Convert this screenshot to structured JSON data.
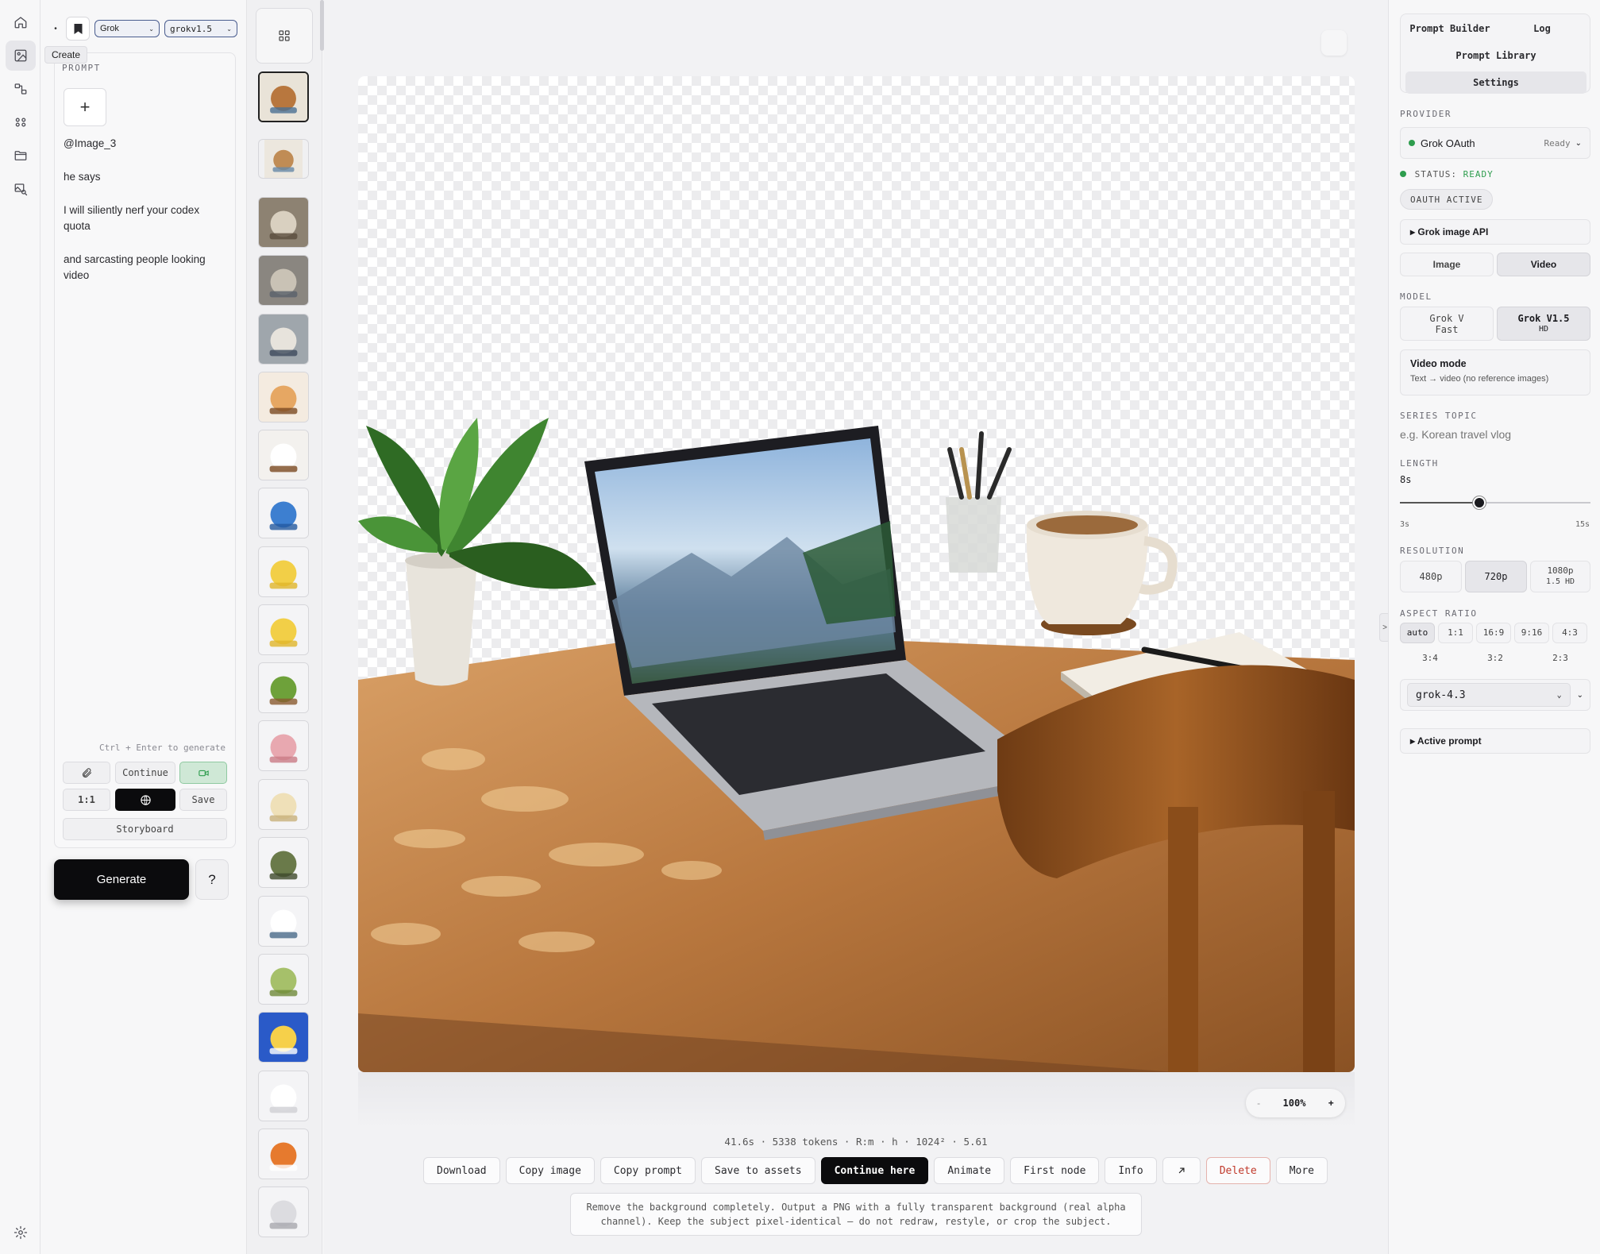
{
  "rail": {
    "tooltip": "Create",
    "icons": [
      "home-icon",
      "image-icon",
      "workflow-icon",
      "filters-icon",
      "folder-icon",
      "image-search-icon"
    ],
    "settings_icon": "gear-icon"
  },
  "prompt_panel": {
    "provider_select": "Grok",
    "model_select": "grokv1.5",
    "section_label": "PROMPT",
    "add_label": "+",
    "lines": [
      "@Image_3",
      "he says",
      "I will siliently nerf your codex quota",
      "and sarcasting people looking video"
    ],
    "hint": "Ctrl + Enter to generate",
    "continue_label": "Continue",
    "ratio_label": "1:1",
    "save_label": "Save",
    "storyboard_label": "Storyboard",
    "generate_label": "Generate",
    "help_label": "?"
  },
  "thumbnails": [
    "desk-laptop",
    "desk-laptop-2",
    "room-collage",
    "laptop-room",
    "person-standing",
    "cat-face",
    "coffee-cup",
    "blue-umbrella",
    "yellow-star",
    "yellow-star-2",
    "avocado-character",
    "paper-crane",
    "perfume-bottle",
    "dragon-figure",
    "astronaut-figure",
    "maple-leaf",
    "korean-poster",
    "white-sneaker",
    "fox-face",
    "glass-item"
  ],
  "canvas": {
    "zoom_minus": "-",
    "zoom_value": "100%",
    "zoom_plus": "+",
    "meta": "41.6s · 5338 tokens · R:m · h · 1024² · 5.61",
    "actions": {
      "download": "Download",
      "copy_image": "Copy image",
      "copy_prompt": "Copy prompt",
      "save_assets": "Save to assets",
      "continue_here": "Continue here",
      "animate": "Animate",
      "first_node": "First node",
      "info": "Info",
      "delete": "Delete",
      "more": "More"
    },
    "description": "Remove the background completely. Output a PNG with a fully transparent background (real alpha channel). Keep the subject pixel-identical — do not redraw, restyle, or crop the subject."
  },
  "settings": {
    "tabs": [
      "Prompt Builder",
      "Log",
      "Prompt Library",
      "Settings"
    ],
    "provider_label": "PROVIDER",
    "provider_name": "Grok OAuth",
    "provider_state": "Ready",
    "status_prefix": "STATUS:",
    "status_value": "READY",
    "oauth_badge": "OAUTH ACTIVE",
    "api_section": "▸ Grok image API",
    "mode_image": "Image",
    "mode_video": "Video",
    "model_label": "MODEL",
    "model_a_line1": "Grok V",
    "model_a_line2": "Fast",
    "model_b_line1": "Grok V1.5",
    "model_b_line2": "HD",
    "video_mode_title": "Video mode",
    "video_mode_desc": "Text → video (no reference images)",
    "series_label": "SERIES TOPIC",
    "series_placeholder": "e.g. Korean travel vlog",
    "length_label": "LENGTH",
    "length_value": "8s",
    "length_fraction": 0.417,
    "length_min": "3s",
    "length_max": "15s",
    "resolution_label": "RESOLUTION",
    "res_480": "480p",
    "res_720": "720p",
    "res_1080_line1": "1080p",
    "res_1080_line2": "1.5 HD",
    "aspect_label": "ASPECT RATIO",
    "aspects_row1": [
      "auto",
      "1:1",
      "16:9",
      "9:16",
      "4:3"
    ],
    "aspects_row2": [
      "3:4",
      "3:2",
      "2:3"
    ],
    "llm_select": "grok-4.3",
    "active_prompt": "▸ Active prompt"
  },
  "colors": {
    "accent": "#0b0b0d",
    "status_green": "#2e9d4e",
    "select_border": "#4a5d8f",
    "delete_red": "#c0392b"
  }
}
